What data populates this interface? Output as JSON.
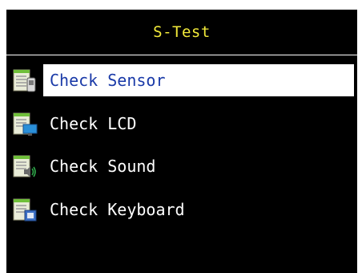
{
  "header": {
    "title": "S-Test",
    "title_color": "#f2ea3a"
  },
  "menu": {
    "selected_index": 0,
    "selected_text_color": "#1a3aa8",
    "items": [
      {
        "label": "Check Sensor",
        "icon": "sensor-icon"
      },
      {
        "label": "Check LCD",
        "icon": "lcd-icon"
      },
      {
        "label": "Check Sound",
        "icon": "sound-icon"
      },
      {
        "label": "Check Keyboard",
        "icon": "keyboard-icon"
      }
    ]
  }
}
